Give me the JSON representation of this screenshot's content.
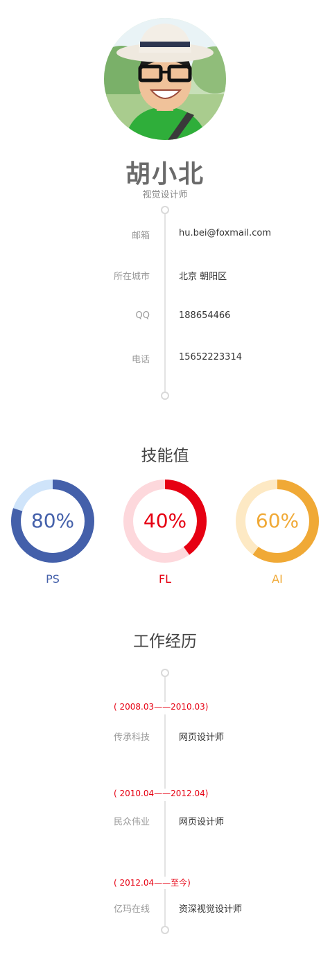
{
  "profile": {
    "name": "胡小北",
    "role": "视觉设计师"
  },
  "contacts": [
    {
      "label": "邮箱",
      "value": "hu.bei@foxmail.com"
    },
    {
      "label": "所在城市",
      "value": "北京 朝阳区"
    },
    {
      "label": "QQ",
      "value": "188654466"
    },
    {
      "label": "电话",
      "value": "15652223314"
    }
  ],
  "skills_title": "技能值",
  "skills": [
    {
      "name": "PS",
      "percent": 80,
      "percent_label": "80%",
      "color": "#4460aa",
      "track": "#cfe4fa"
    },
    {
      "name": "FL",
      "percent": 40,
      "percent_label": "40%",
      "color": "#e60012",
      "track": "#fdd8dc"
    },
    {
      "name": "AI",
      "percent": 60,
      "percent_label": "60%",
      "color": "#f0a936",
      "track": "#fde9c4"
    }
  ],
  "experience_title": "工作经历",
  "experience": [
    {
      "period": "( 2008.03——2010.03)",
      "company": "传承科技",
      "position": "网页设计师"
    },
    {
      "period": "( 2010.04——2012.04)",
      "company": "民众伟业",
      "position": "网页设计师"
    },
    {
      "period": "( 2012.04——至今)",
      "company": "亿玛在线",
      "position": "资深视觉设计师"
    }
  ]
}
